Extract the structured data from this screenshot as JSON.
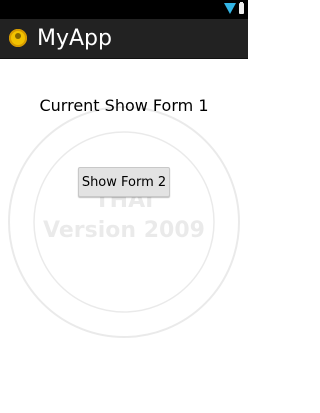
{
  "status_bar": {
    "icons": [
      "wifi-icon",
      "battery-icon"
    ]
  },
  "action_bar": {
    "title": "MyApp",
    "icon": "app-icon"
  },
  "main": {
    "current_label": "Current Show Form 1",
    "show_button_label": "Show Form 2"
  },
  "watermark": {
    "line1": "THAI",
    "line2": "Version 2009"
  },
  "colors": {
    "status_bar": "#000000",
    "action_bar": "#222222",
    "accent": "#33b5e5",
    "background": "#ffffff"
  }
}
